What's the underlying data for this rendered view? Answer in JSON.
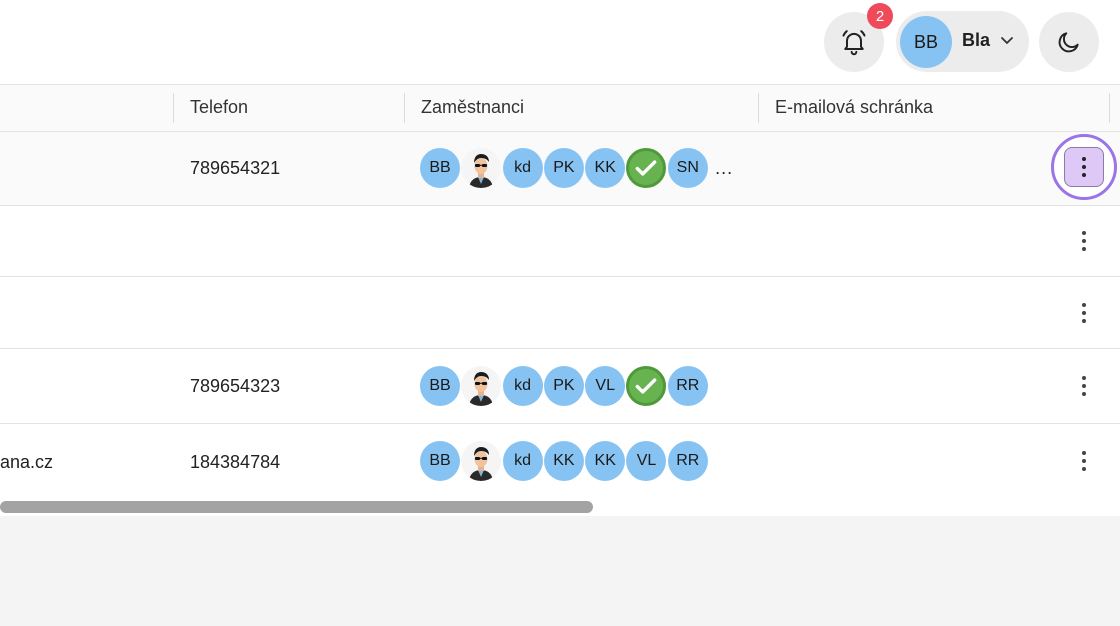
{
  "header": {
    "notification_count": "2",
    "user_initials": "BB",
    "user_name": "Bla"
  },
  "icons": {
    "bell": "bell-icon",
    "chevron": "chevron-down-icon",
    "theme": "moon-icon",
    "more": "kebab-menu-icon",
    "check": "check-icon",
    "photo": "man-sunglasses-avatar"
  },
  "colors": {
    "avatar": "#87c3f2",
    "badge": "#ef4a5a",
    "check": "#66b34f",
    "focus_ring": "#9b74e8"
  },
  "table": {
    "columns": [
      "Telefon",
      "Zaměstnanci",
      "E-mailová schránka"
    ],
    "rows": [
      {
        "email_partial": "",
        "phone": "789654321",
        "employees": [
          "BB",
          "photo",
          "kd",
          "PK",
          "KK",
          "check",
          "SN"
        ],
        "more": "..."
      },
      {
        "email_partial": "",
        "phone": "",
        "employees": [],
        "more": ""
      },
      {
        "email_partial": "",
        "phone": "",
        "employees": [],
        "more": ""
      },
      {
        "email_partial": "",
        "phone": "789654323",
        "employees": [
          "BB",
          "photo",
          "kd",
          "PK",
          "VL",
          "check",
          "RR"
        ],
        "more": ""
      },
      {
        "email_partial": "ana.cz",
        "phone": "184384784",
        "employees": [
          "BB",
          "photo",
          "kd",
          "KK",
          "KK",
          "VL",
          "RR"
        ],
        "more": ""
      }
    ]
  }
}
